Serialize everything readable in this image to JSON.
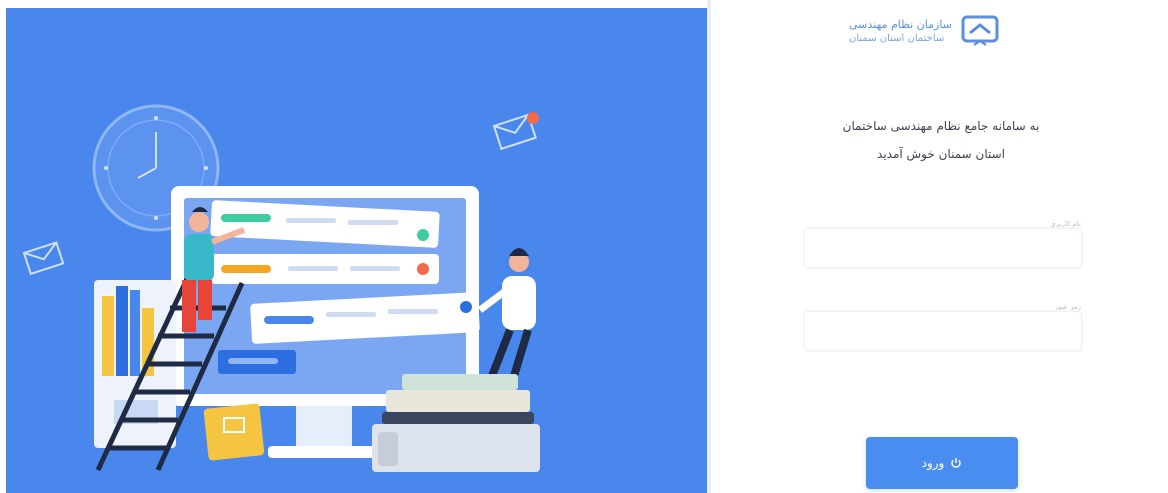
{
  "brand": {
    "line1": "سازمان نظام مهندسی",
    "line2": "ساختمان استان سمنان",
    "emblem_icon": "organization-emblem-icon"
  },
  "welcome": {
    "line1": "به سامانه جامع نظام مهندسی ساختمان",
    "line2": "استان سمنان خوش آمدید"
  },
  "form": {
    "username_label": "نام کاربری",
    "password_label": "رمز عبور",
    "login_label": "ورود",
    "login_icon": "power-icon"
  },
  "colors": {
    "primary": "#4a87ec",
    "button": "#4a8df0",
    "text": "#3e4451"
  }
}
